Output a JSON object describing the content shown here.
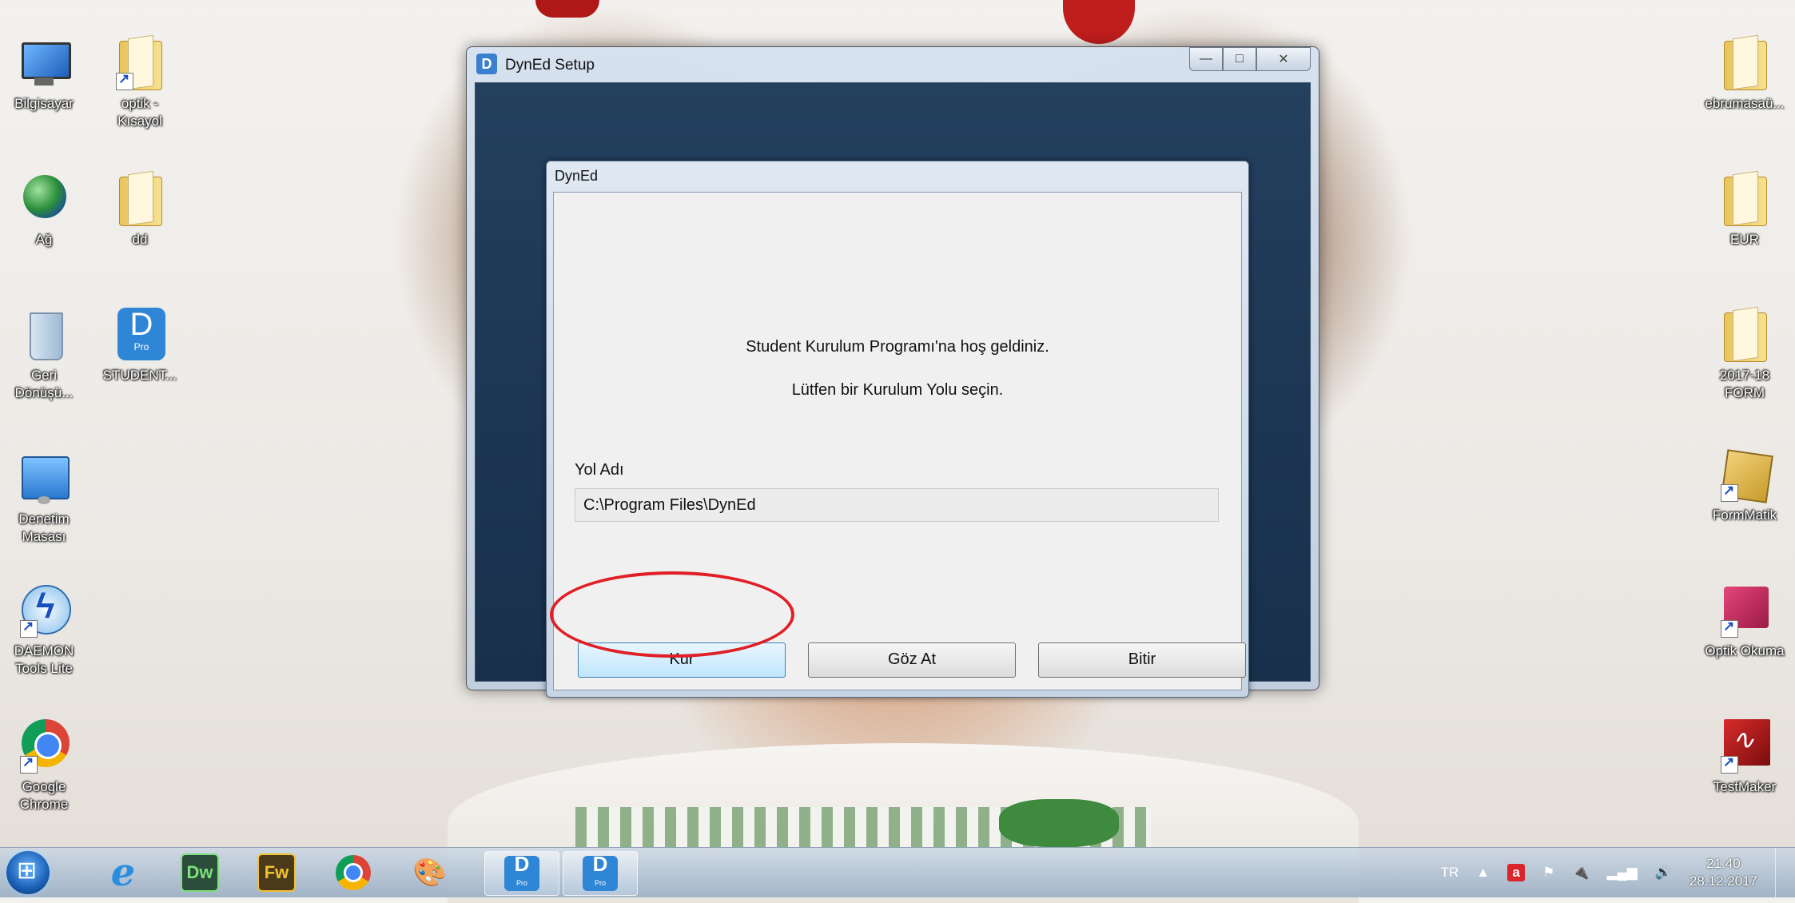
{
  "desktop": {
    "left_icons": [
      {
        "label": "Bilgisayar"
      },
      {
        "label": "optik -\nKısayol"
      },
      {
        "label": "Ağ"
      },
      {
        "label": "dd"
      },
      {
        "label": "Geri\nDönüşü..."
      },
      {
        "label": "STUDENT..."
      },
      {
        "label": "Denetim\nMasası"
      },
      {
        "label": "DAEMON\nTools Lite"
      },
      {
        "label": "Google\nChrome"
      }
    ],
    "right_icons": [
      {
        "label": "ebrumasaü..."
      },
      {
        "label": "EUR"
      },
      {
        "label": "2017-18\nFORM"
      },
      {
        "label": "FormMatik"
      },
      {
        "label": "Optik Okuma"
      },
      {
        "label": "TestMaker"
      }
    ]
  },
  "window": {
    "title": "DynEd Setup",
    "app_icon_letter": "D",
    "controls": {
      "minimize": "—",
      "maximize": "□",
      "close": "✕"
    }
  },
  "dialog": {
    "title": "DynEd",
    "welcome_text": "Student Kurulum Programı'na hoş geldiniz.",
    "instruction_text": "Lütfen bir Kurulum Yolu seçin.",
    "path_label": "Yol Adı",
    "path_value": "C:\\Program Files\\DynEd",
    "buttons": {
      "install": "Kur",
      "browse": "Göz At",
      "finish": "Bitir"
    }
  },
  "pro_badge": "Pro",
  "taskbar": {
    "apps": [
      {
        "name": "Internet Explorer",
        "glyph": "e"
      },
      {
        "name": "Dreamweaver",
        "glyph": "Dw"
      },
      {
        "name": "Fireworks",
        "glyph": "Fw"
      },
      {
        "name": "Chrome",
        "glyph": ""
      },
      {
        "name": "Paint",
        "glyph": "🎨"
      },
      {
        "name": "DynEd Pro",
        "glyph": "D"
      },
      {
        "name": "DynEd Pro",
        "glyph": "D"
      }
    ],
    "tray": {
      "language": "TR",
      "time": "21:40",
      "date": "28.12.2017"
    }
  },
  "colors": {
    "accent_red": "#e01f26",
    "window_client": "#1c3553",
    "kur_button": "#bee6fd"
  }
}
